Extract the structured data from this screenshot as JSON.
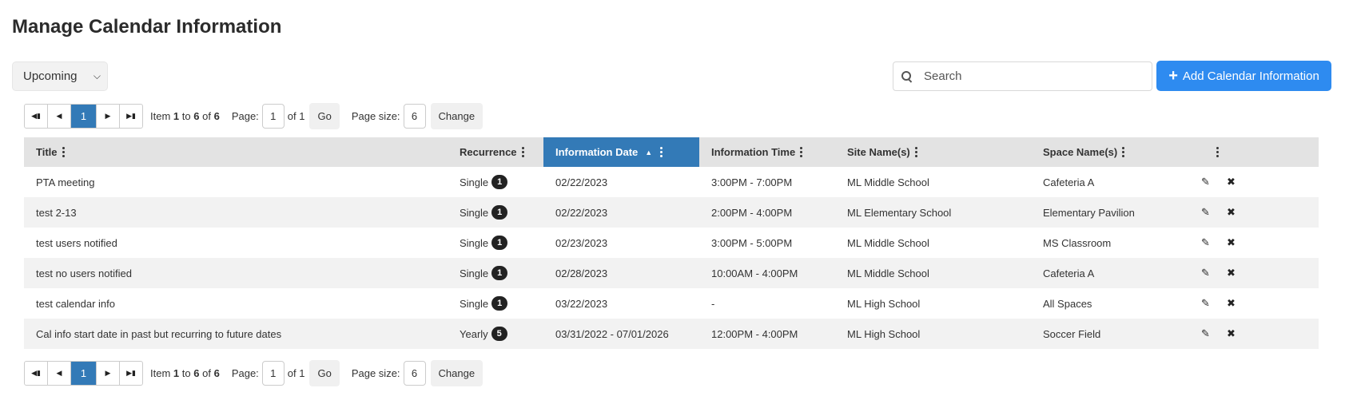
{
  "page_title": "Manage Calendar Information",
  "filter": {
    "selected": "Upcoming"
  },
  "search": {
    "placeholder": "Search"
  },
  "add_button_label": "Add Calendar Information",
  "pager": {
    "current_page": "1",
    "item_prefix": "Item",
    "item_from": "1",
    "item_to_word": "to",
    "item_to": "6",
    "item_of_word": "of",
    "item_total": "6",
    "page_label": "Page:",
    "page_value": "1",
    "of_pages": "of 1",
    "go_label": "Go",
    "page_size_label": "Page size:",
    "page_size_value": "6",
    "change_label": "Change"
  },
  "columns": {
    "title": "Title",
    "recurrence": "Recurrence",
    "info_date": "Information Date",
    "info_time": "Information Time",
    "site": "Site Name(s)",
    "space": "Space Name(s)"
  },
  "rows": [
    {
      "title": "PTA meeting",
      "recurrence": "Single",
      "count": "1",
      "date": "02/22/2023",
      "time": "3:00PM - 7:00PM",
      "site": "ML Middle School",
      "space": "Cafeteria A"
    },
    {
      "title": "test 2-13",
      "recurrence": "Single",
      "count": "1",
      "date": "02/22/2023",
      "time": "2:00PM - 4:00PM",
      "site": "ML Elementary School",
      "space": "Elementary Pavilion"
    },
    {
      "title": "test users notified",
      "recurrence": "Single",
      "count": "1",
      "date": "02/23/2023",
      "time": "3:00PM - 5:00PM",
      "site": "ML Middle School",
      "space": "MS Classroom"
    },
    {
      "title": "test no users notified",
      "recurrence": "Single",
      "count": "1",
      "date": "02/28/2023",
      "time": "10:00AM - 4:00PM",
      "site": "ML Middle School",
      "space": "Cafeteria A"
    },
    {
      "title": "test calendar info",
      "recurrence": "Single",
      "count": "1",
      "date": "03/22/2023",
      "time": "-",
      "site": "ML High School",
      "space": "All Spaces"
    },
    {
      "title": "Cal info start date in past but recurring to future dates",
      "recurrence": "Yearly",
      "count": "5",
      "date": "03/31/2022 - 07/01/2026",
      "time": "12:00PM - 4:00PM",
      "site": "ML High School",
      "space": "Soccer Field"
    }
  ],
  "icons": {
    "edit": "edit-icon",
    "delete": "close-icon",
    "search": "search-icon",
    "sort": "sort-ascending-icon"
  },
  "colors": {
    "accent": "#337ab7",
    "button": "#2e8bf0"
  }
}
